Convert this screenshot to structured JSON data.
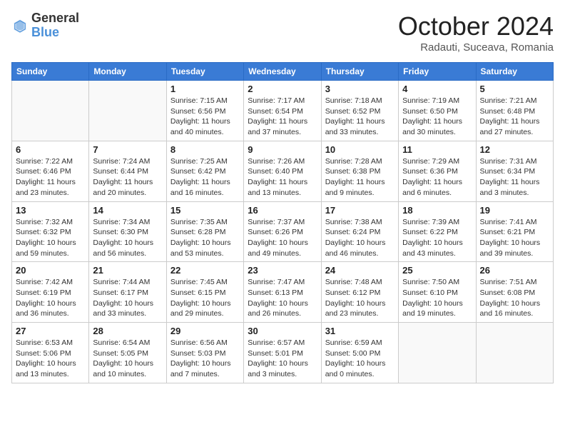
{
  "logo": {
    "general": "General",
    "blue": "Blue"
  },
  "title": "October 2024",
  "location": "Radauti, Suceava, Romania",
  "days_of_week": [
    "Sunday",
    "Monday",
    "Tuesday",
    "Wednesday",
    "Thursday",
    "Friday",
    "Saturday"
  ],
  "weeks": [
    [
      {
        "day": "",
        "detail": ""
      },
      {
        "day": "",
        "detail": ""
      },
      {
        "day": "1",
        "detail": "Sunrise: 7:15 AM\nSunset: 6:56 PM\nDaylight: 11 hours and 40 minutes."
      },
      {
        "day": "2",
        "detail": "Sunrise: 7:17 AM\nSunset: 6:54 PM\nDaylight: 11 hours and 37 minutes."
      },
      {
        "day": "3",
        "detail": "Sunrise: 7:18 AM\nSunset: 6:52 PM\nDaylight: 11 hours and 33 minutes."
      },
      {
        "day": "4",
        "detail": "Sunrise: 7:19 AM\nSunset: 6:50 PM\nDaylight: 11 hours and 30 minutes."
      },
      {
        "day": "5",
        "detail": "Sunrise: 7:21 AM\nSunset: 6:48 PM\nDaylight: 11 hours and 27 minutes."
      }
    ],
    [
      {
        "day": "6",
        "detail": "Sunrise: 7:22 AM\nSunset: 6:46 PM\nDaylight: 11 hours and 23 minutes."
      },
      {
        "day": "7",
        "detail": "Sunrise: 7:24 AM\nSunset: 6:44 PM\nDaylight: 11 hours and 20 minutes."
      },
      {
        "day": "8",
        "detail": "Sunrise: 7:25 AM\nSunset: 6:42 PM\nDaylight: 11 hours and 16 minutes."
      },
      {
        "day": "9",
        "detail": "Sunrise: 7:26 AM\nSunset: 6:40 PM\nDaylight: 11 hours and 13 minutes."
      },
      {
        "day": "10",
        "detail": "Sunrise: 7:28 AM\nSunset: 6:38 PM\nDaylight: 11 hours and 9 minutes."
      },
      {
        "day": "11",
        "detail": "Sunrise: 7:29 AM\nSunset: 6:36 PM\nDaylight: 11 hours and 6 minutes."
      },
      {
        "day": "12",
        "detail": "Sunrise: 7:31 AM\nSunset: 6:34 PM\nDaylight: 11 hours and 3 minutes."
      }
    ],
    [
      {
        "day": "13",
        "detail": "Sunrise: 7:32 AM\nSunset: 6:32 PM\nDaylight: 10 hours and 59 minutes."
      },
      {
        "day": "14",
        "detail": "Sunrise: 7:34 AM\nSunset: 6:30 PM\nDaylight: 10 hours and 56 minutes."
      },
      {
        "day": "15",
        "detail": "Sunrise: 7:35 AM\nSunset: 6:28 PM\nDaylight: 10 hours and 53 minutes."
      },
      {
        "day": "16",
        "detail": "Sunrise: 7:37 AM\nSunset: 6:26 PM\nDaylight: 10 hours and 49 minutes."
      },
      {
        "day": "17",
        "detail": "Sunrise: 7:38 AM\nSunset: 6:24 PM\nDaylight: 10 hours and 46 minutes."
      },
      {
        "day": "18",
        "detail": "Sunrise: 7:39 AM\nSunset: 6:22 PM\nDaylight: 10 hours and 43 minutes."
      },
      {
        "day": "19",
        "detail": "Sunrise: 7:41 AM\nSunset: 6:21 PM\nDaylight: 10 hours and 39 minutes."
      }
    ],
    [
      {
        "day": "20",
        "detail": "Sunrise: 7:42 AM\nSunset: 6:19 PM\nDaylight: 10 hours and 36 minutes."
      },
      {
        "day": "21",
        "detail": "Sunrise: 7:44 AM\nSunset: 6:17 PM\nDaylight: 10 hours and 33 minutes."
      },
      {
        "day": "22",
        "detail": "Sunrise: 7:45 AM\nSunset: 6:15 PM\nDaylight: 10 hours and 29 minutes."
      },
      {
        "day": "23",
        "detail": "Sunrise: 7:47 AM\nSunset: 6:13 PM\nDaylight: 10 hours and 26 minutes."
      },
      {
        "day": "24",
        "detail": "Sunrise: 7:48 AM\nSunset: 6:12 PM\nDaylight: 10 hours and 23 minutes."
      },
      {
        "day": "25",
        "detail": "Sunrise: 7:50 AM\nSunset: 6:10 PM\nDaylight: 10 hours and 19 minutes."
      },
      {
        "day": "26",
        "detail": "Sunrise: 7:51 AM\nSunset: 6:08 PM\nDaylight: 10 hours and 16 minutes."
      }
    ],
    [
      {
        "day": "27",
        "detail": "Sunrise: 6:53 AM\nSunset: 5:06 PM\nDaylight: 10 hours and 13 minutes."
      },
      {
        "day": "28",
        "detail": "Sunrise: 6:54 AM\nSunset: 5:05 PM\nDaylight: 10 hours and 10 minutes."
      },
      {
        "day": "29",
        "detail": "Sunrise: 6:56 AM\nSunset: 5:03 PM\nDaylight: 10 hours and 7 minutes."
      },
      {
        "day": "30",
        "detail": "Sunrise: 6:57 AM\nSunset: 5:01 PM\nDaylight: 10 hours and 3 minutes."
      },
      {
        "day": "31",
        "detail": "Sunrise: 6:59 AM\nSunset: 5:00 PM\nDaylight: 10 hours and 0 minutes."
      },
      {
        "day": "",
        "detail": ""
      },
      {
        "day": "",
        "detail": ""
      }
    ]
  ]
}
